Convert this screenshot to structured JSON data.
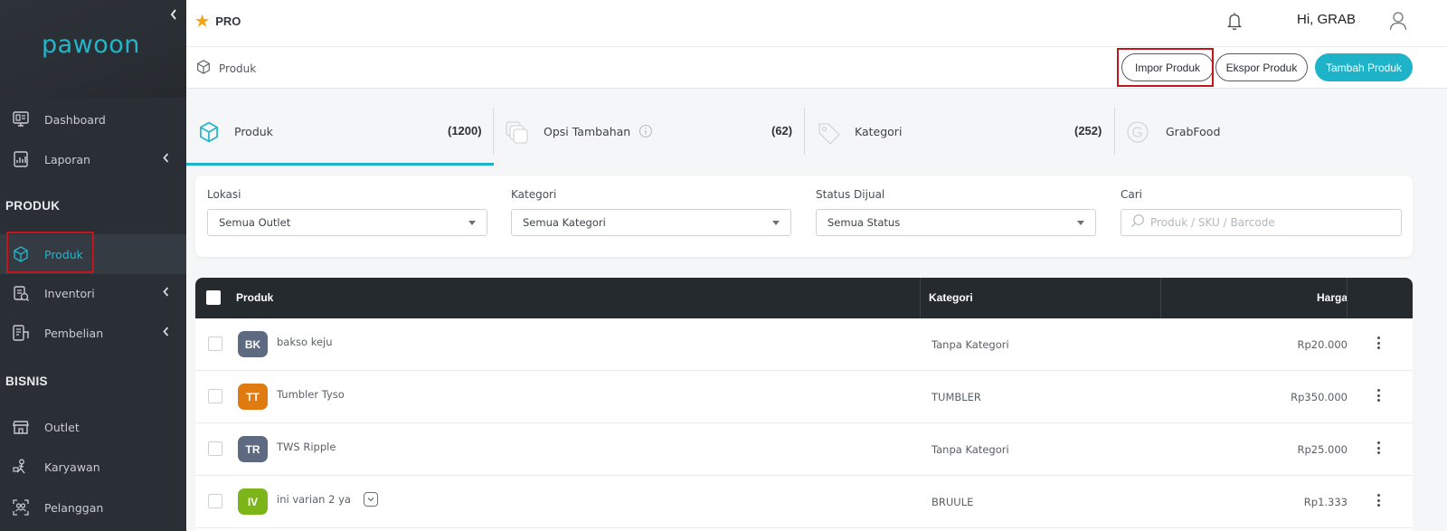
{
  "app": {
    "logo_text": "pawoon",
    "plan_label": "PRO",
    "greeting": "Hi, GRAB",
    "accent_color": "#1fb3c9"
  },
  "sidebar": {
    "collapse_icon": "chevron-left-icon",
    "items": [
      {
        "label": "Dashboard",
        "icon": "monitor-icon"
      },
      {
        "label": "Laporan",
        "icon": "report-chart-icon"
      },
      {
        "section": "PRODUK"
      },
      {
        "label": "Produk",
        "icon": "box-icon",
        "active": true
      },
      {
        "label": "Inventori",
        "icon": "inventory-icon"
      },
      {
        "label": "Pembelian",
        "icon": "purchase-icon"
      },
      {
        "section": "BISNIS"
      },
      {
        "label": "Outlet",
        "icon": "store-icon"
      },
      {
        "label": "Karyawan",
        "icon": "employee-icon"
      },
      {
        "label": "Pelanggan",
        "icon": "customers-icon"
      }
    ]
  },
  "breadcrumb": {
    "label": "Produk"
  },
  "actions": {
    "import_label": "Impor Produk",
    "export_label": "Ekspor Produk",
    "add_label": "Tambah Produk"
  },
  "tabs": [
    {
      "label": "Produk",
      "count": "(1200)",
      "icon": "box-icon",
      "active": true
    },
    {
      "label": "Opsi Tambahan",
      "count": "(62)",
      "icon": "layers-icon"
    },
    {
      "label": "Kategori",
      "count": "(252)",
      "icon": "tag-icon"
    },
    {
      "label": "GrabFood",
      "count": "",
      "icon": "grab-g-icon"
    }
  ],
  "filters": {
    "location": {
      "label": "Lokasi",
      "value": "Semua Outlet"
    },
    "category": {
      "label": "Kategori",
      "value": "Semua Kategori"
    },
    "status": {
      "label": "Status Dijual",
      "value": "Semua Status"
    },
    "search": {
      "label": "Cari",
      "placeholder": "Produk / SKU / Barcode"
    }
  },
  "table": {
    "headers": {
      "product": "Produk",
      "category": "Kategori",
      "price": "Harga"
    },
    "rows": [
      {
        "initials": "BK",
        "name": "bakso keju",
        "category": "Tanpa Kategori",
        "price": "Rp20.000",
        "color": "#5d6a82"
      },
      {
        "initials": "TT",
        "name": "Tumbler Tyso",
        "category": "TUMBLER",
        "price": "Rp350.000",
        "color": "#e07b12"
      },
      {
        "initials": "TR",
        "name": "TWS Ripple",
        "category": "Tanpa Kategori",
        "price": "Rp25.000",
        "color": "#5d6a82"
      },
      {
        "initials": "IV",
        "name": "ini varian 2 ya",
        "category": "BRUULE",
        "price": "Rp1.333",
        "color": "#7cb518",
        "has_variants": true
      }
    ]
  }
}
